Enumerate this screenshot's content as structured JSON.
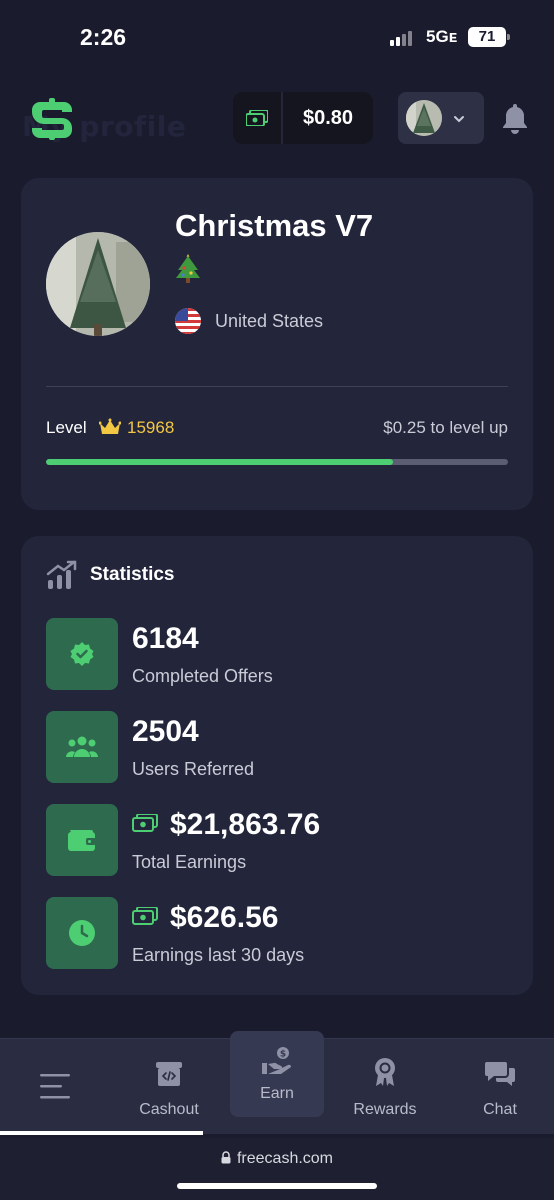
{
  "status_bar": {
    "time": "2:26",
    "network": "5Gᴇ",
    "battery": "71"
  },
  "header": {
    "ghost_title": "My profile",
    "balance": "$0.80"
  },
  "profile": {
    "name": "Christmas V7",
    "emoji": "🎄",
    "country": "United States",
    "level_label": "Level",
    "level_value": "15968",
    "level_up_text": "$0.25 to level up",
    "level_progress": 0.75
  },
  "statistics": {
    "title": "Statistics",
    "items": [
      {
        "value": "6184",
        "label": "Completed Offers",
        "icon": "check-badge-icon"
      },
      {
        "value": "2504",
        "label": "Users Referred",
        "icon": "users-icon"
      },
      {
        "value": "$21,863.76",
        "label": "Total Earnings",
        "icon": "wallet-icon"
      },
      {
        "value": "$626.56",
        "label": "Earnings last 30 days",
        "icon": "clock-icon"
      }
    ]
  },
  "nav": {
    "cashout": "Cashout",
    "earn": "Earn",
    "rewards": "Rewards",
    "chat": "Chat"
  },
  "url": "freecash.com",
  "colors": {
    "accent_green": "#4ece73",
    "gold": "#f2c744",
    "card_bg": "#23253b",
    "page_bg": "#1a1c2e"
  }
}
